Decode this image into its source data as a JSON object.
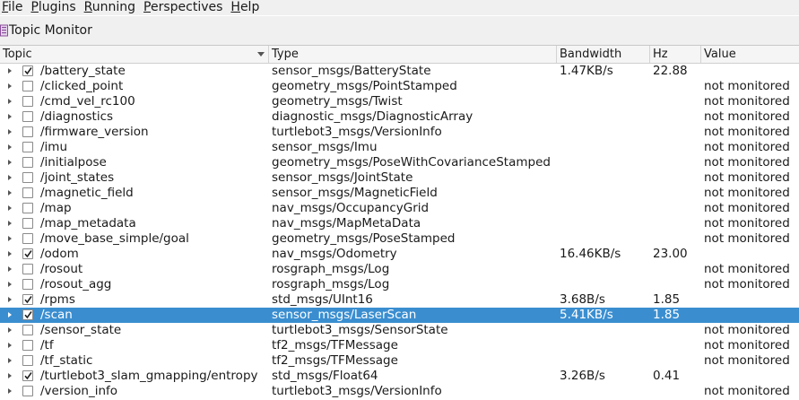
{
  "menu": [
    {
      "mnemonic": "F",
      "rest": "ile"
    },
    {
      "mnemonic": "P",
      "rest": "lugins"
    },
    {
      "mnemonic": "R",
      "rest": "unning"
    },
    {
      "mnemonic": "P",
      "rest": "erspectives"
    },
    {
      "mnemonic": "H",
      "rest": "elp"
    }
  ],
  "window": {
    "title": "Topic Monitor"
  },
  "columns": {
    "topic": "Topic",
    "type": "Type",
    "bandwidth": "Bandwidth",
    "hz": "Hz",
    "value": "Value"
  },
  "rows": [
    {
      "topic": "/battery_state",
      "type": "sensor_msgs/BatteryState",
      "bandwidth": "1.47KB/s",
      "hz": "22.88",
      "value": "",
      "checked": true,
      "selected": false
    },
    {
      "topic": "/clicked_point",
      "type": "geometry_msgs/PointStamped",
      "bandwidth": "",
      "hz": "",
      "value": "not monitored",
      "checked": false,
      "selected": false
    },
    {
      "topic": "/cmd_vel_rc100",
      "type": "geometry_msgs/Twist",
      "bandwidth": "",
      "hz": "",
      "value": "not monitored",
      "checked": false,
      "selected": false
    },
    {
      "topic": "/diagnostics",
      "type": "diagnostic_msgs/DiagnosticArray",
      "bandwidth": "",
      "hz": "",
      "value": "not monitored",
      "checked": false,
      "selected": false
    },
    {
      "topic": "/firmware_version",
      "type": "turtlebot3_msgs/VersionInfo",
      "bandwidth": "",
      "hz": "",
      "value": "not monitored",
      "checked": false,
      "selected": false
    },
    {
      "topic": "/imu",
      "type": "sensor_msgs/Imu",
      "bandwidth": "",
      "hz": "",
      "value": "not monitored",
      "checked": false,
      "selected": false
    },
    {
      "topic": "/initialpose",
      "type": "geometry_msgs/PoseWithCovarianceStamped",
      "bandwidth": "",
      "hz": "",
      "value": "not monitored",
      "checked": false,
      "selected": false
    },
    {
      "topic": "/joint_states",
      "type": "sensor_msgs/JointState",
      "bandwidth": "",
      "hz": "",
      "value": "not monitored",
      "checked": false,
      "selected": false
    },
    {
      "topic": "/magnetic_field",
      "type": "sensor_msgs/MagneticField",
      "bandwidth": "",
      "hz": "",
      "value": "not monitored",
      "checked": false,
      "selected": false
    },
    {
      "topic": "/map",
      "type": "nav_msgs/OccupancyGrid",
      "bandwidth": "",
      "hz": "",
      "value": "not monitored",
      "checked": false,
      "selected": false
    },
    {
      "topic": "/map_metadata",
      "type": "nav_msgs/MapMetaData",
      "bandwidth": "",
      "hz": "",
      "value": "not monitored",
      "checked": false,
      "selected": false
    },
    {
      "topic": "/move_base_simple/goal",
      "type": "geometry_msgs/PoseStamped",
      "bandwidth": "",
      "hz": "",
      "value": "not monitored",
      "checked": false,
      "selected": false
    },
    {
      "topic": "/odom",
      "type": "nav_msgs/Odometry",
      "bandwidth": "16.46KB/s",
      "hz": "23.00",
      "value": "",
      "checked": true,
      "selected": false
    },
    {
      "topic": "/rosout",
      "type": "rosgraph_msgs/Log",
      "bandwidth": "",
      "hz": "",
      "value": "not monitored",
      "checked": false,
      "selected": false
    },
    {
      "topic": "/rosout_agg",
      "type": "rosgraph_msgs/Log",
      "bandwidth": "",
      "hz": "",
      "value": "not monitored",
      "checked": false,
      "selected": false
    },
    {
      "topic": "/rpms",
      "type": "std_msgs/UInt16",
      "bandwidth": "3.68B/s",
      "hz": "1.85",
      "value": "",
      "checked": true,
      "selected": false
    },
    {
      "topic": "/scan",
      "type": "sensor_msgs/LaserScan",
      "bandwidth": "5.41KB/s",
      "hz": "1.85",
      "value": "",
      "checked": true,
      "selected": true
    },
    {
      "topic": "/sensor_state",
      "type": "turtlebot3_msgs/SensorState",
      "bandwidth": "",
      "hz": "",
      "value": "not monitored",
      "checked": false,
      "selected": false
    },
    {
      "topic": "/tf",
      "type": "tf2_msgs/TFMessage",
      "bandwidth": "",
      "hz": "",
      "value": "not monitored",
      "checked": false,
      "selected": false
    },
    {
      "topic": "/tf_static",
      "type": "tf2_msgs/TFMessage",
      "bandwidth": "",
      "hz": "",
      "value": "not monitored",
      "checked": false,
      "selected": false
    },
    {
      "topic": "/turtlebot3_slam_gmapping/entropy",
      "type": "std_msgs/Float64",
      "bandwidth": "3.26B/s",
      "hz": "0.41",
      "value": "",
      "checked": true,
      "selected": false
    },
    {
      "topic": "/version_info",
      "type": "turtlebot3_msgs/VersionInfo",
      "bandwidth": "",
      "hz": "",
      "value": "not monitored",
      "checked": false,
      "selected": false
    }
  ],
  "colors": {
    "selection": "#3a8ed0",
    "header_bg": "#f5f5f5",
    "chrome_bg": "#f0f0f0"
  }
}
